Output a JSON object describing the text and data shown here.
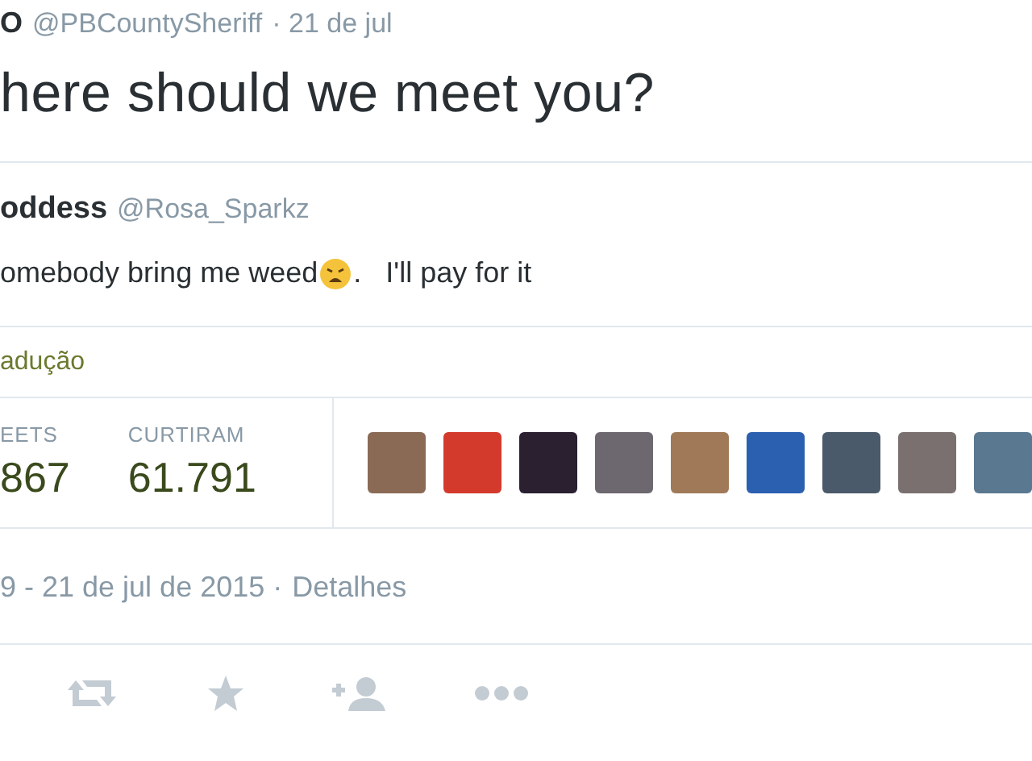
{
  "tweet": {
    "author_name": "O",
    "handle": "@PBCountySheriff",
    "time": "· 21 de jul",
    "text": "here should we meet you?"
  },
  "quoted": {
    "author_name": "oddess",
    "handle": "@Rosa_Sparkz",
    "text_before": "omebody bring me weed",
    "text_after": ".   I'll pay for it"
  },
  "translation_link": "adução",
  "stats": [
    {
      "label": "EETS",
      "value": "867"
    },
    {
      "label": "CURTIRAM",
      "value": "61.791"
    }
  ],
  "avatars": [
    {
      "color": "#8a6a55"
    },
    {
      "color": "#d33a2c"
    },
    {
      "color": "#2a2030"
    },
    {
      "color": "#6d6870"
    },
    {
      "color": "#a07a58"
    },
    {
      "color": "#2b5fb0"
    },
    {
      "color": "#4a5a6a"
    },
    {
      "color": "#7a7070"
    },
    {
      "color": "#5a7890"
    }
  ],
  "timestamp": "9 - 21 de jul de 2015 ·",
  "details_link": "Detalhes"
}
